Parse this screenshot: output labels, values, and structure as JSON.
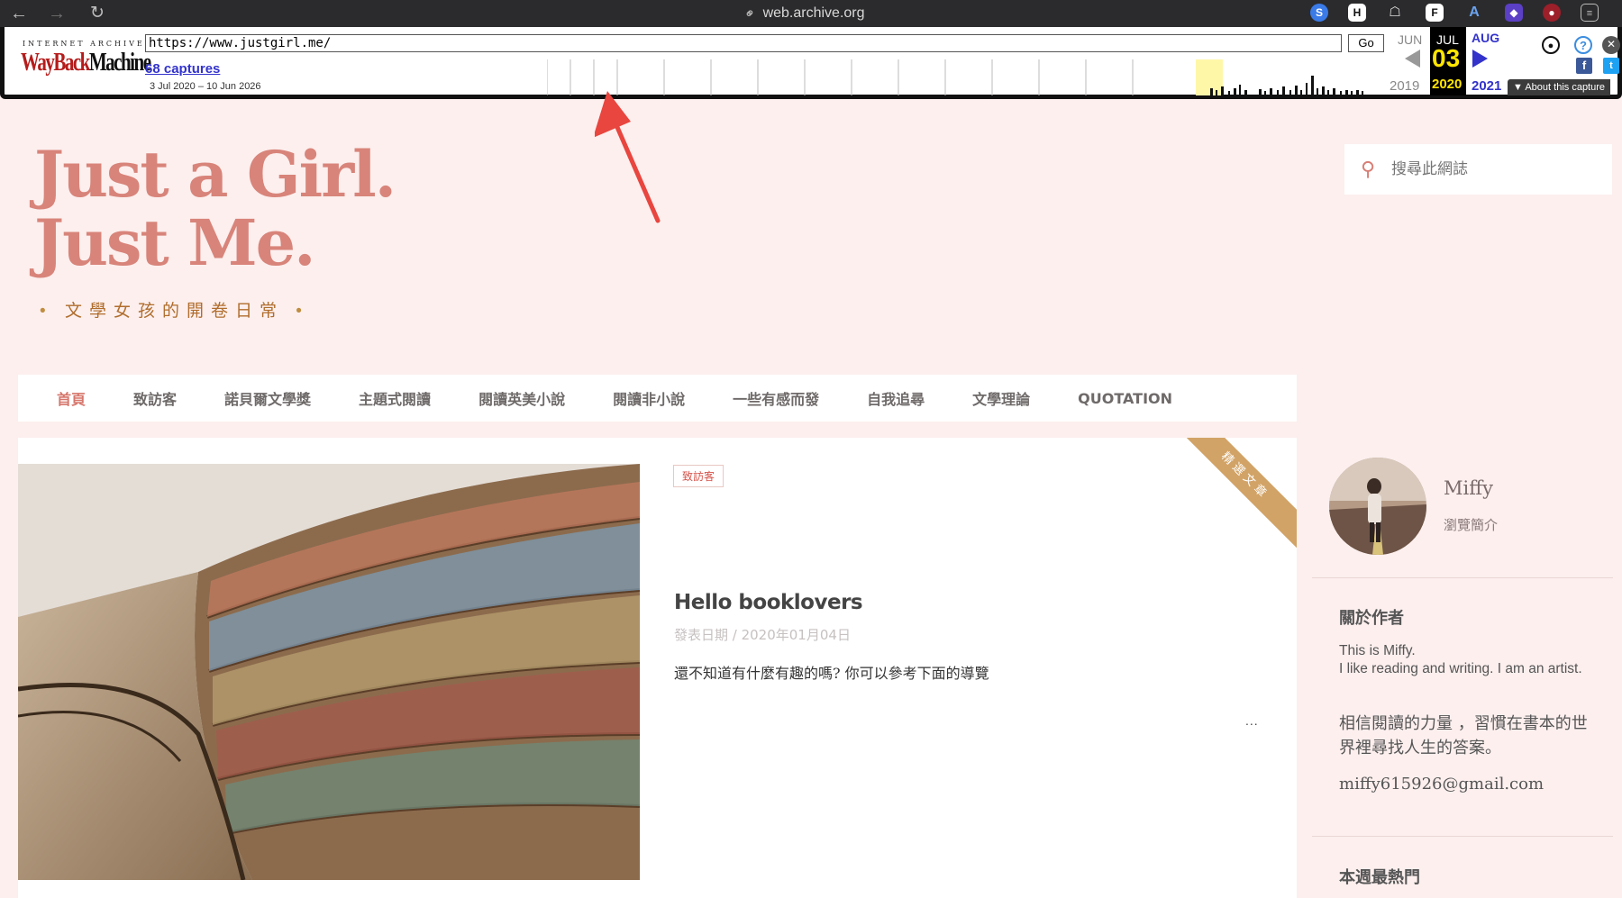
{
  "browser": {
    "url": "web.archive.org"
  },
  "wayback": {
    "logo_top": "INTERNET ARCHIVE",
    "logo_left": "WayBack",
    "logo_right": "Machine",
    "url_value": "https://www.justgirl.me/",
    "go_label": "Go",
    "captures_label": "68 captures",
    "date_range": "3 Jul 2020 – 10 Jun 2026",
    "prev_month": "JUN",
    "cur_month": "JUL",
    "next_month": "AUG",
    "cur_day": "03",
    "prev_year": "2019",
    "cur_year": "2020",
    "next_year": "2021",
    "about_label": "About this capture"
  },
  "site": {
    "title_line1": "Just a Girl.",
    "title_line2": "Just Me.",
    "tagline": "文學女孩的開卷日常",
    "search_placeholder": "搜尋此網誌"
  },
  "nav": {
    "items": [
      "首頁",
      "致訪客",
      "諾貝爾文學獎",
      "主題式閱讀",
      "閱讀英美小說",
      "閱讀非小說",
      "一些有感而發",
      "自我追尋",
      "文學理論",
      "QUOTATION"
    ]
  },
  "post": {
    "category": "致訪客",
    "ribbon": "精選文章",
    "title": "Hello booklovers",
    "meta": "發表日期 / 2020年01月04日",
    "excerpt": "還不知道有什麼有趣的嗎? 你可以參考下面的導覽",
    "more": "..."
  },
  "sidebar": {
    "author_name": "Miffy",
    "profile_link": "瀏覽簡介",
    "about_heading": "關於作者",
    "about_en": "This is Miffy.\nI like reading and writing. I am an artist.",
    "about_zh": "相信閱讀的力量 ，習慣在書本的世界裡尋找人生的答案。",
    "email": "miffy615926@gmail.com",
    "popular_heading": "本週最熱門"
  },
  "colors": {
    "page_bg": "#fcefee",
    "title_color": "#d8847a",
    "accent": "#d6766c",
    "ribbon": "#d2a366",
    "wayback_link": "#3333cc",
    "annotation_arrow": "#e8463f"
  }
}
